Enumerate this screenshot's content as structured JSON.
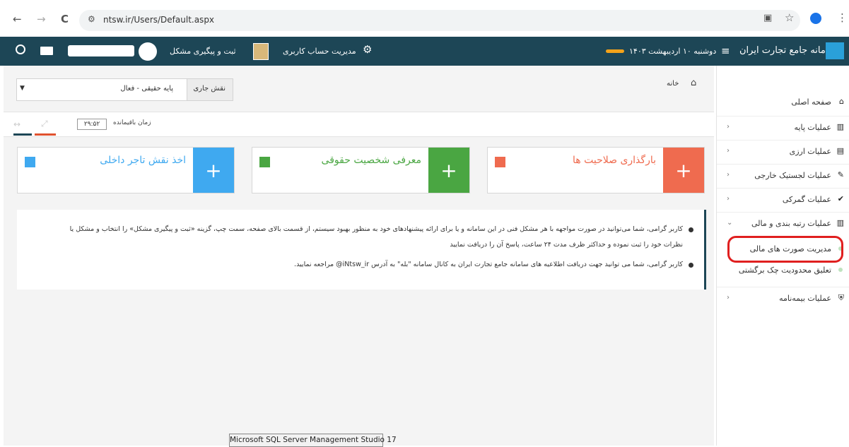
{
  "browser": {
    "back": "←",
    "forward": "→",
    "reload": "C",
    "url": "ntsw.ir/Users/Default.aspx"
  },
  "header": {
    "brand": "سامانه جامع تجارت ایران",
    "date": "دوشنبه ۱۰ اردیبهشت ۱۴۰۳",
    "account_mgmt": "مدیریت حساب کاربری",
    "register_issue": "ثبت و پیگیری مشکل"
  },
  "breadcrumb": {
    "home": "خانه"
  },
  "role": {
    "label": "نقش جاری",
    "value": "پایه حقیقی - فعال"
  },
  "timer": {
    "label": "زمان باقیمانده",
    "value": "۲۹:۵۲"
  },
  "cards": [
    {
      "title": "بارگذاری صلاحیت ها",
      "color": "#ef6b4f"
    },
    {
      "title": "معرفی شخصیت حقوقی",
      "color": "#4aa642"
    },
    {
      "title": "اخذ نقش تاجر داخلی",
      "color": "#3fa9f0"
    }
  ],
  "notice": {
    "line1": "کاربر گرامی، شما می‌توانید در صورت مواجهه با هر مشکل فنی در این سامانه و یا برای ارائه پیشنهادهای خود به منظور بهبود سیستم، از قسمت بالای صفحه، سمت چپ، گزینه «ثبت و پیگیری مشکل» را انتخاب و مشکل یا",
    "line2": "نظرات خود را ثبت نموده و حداکثر ظرف مدت ۲۴ ساعت، پاسخ آن را دریافت نمایید",
    "line3": "کاربر گرامی، شما می توانید جهت دریافت اطلاعیه های سامانه جامع تجارت ایران به کانال سامانه \"بله\" به آدرس iNtsw_ir@ مراجعه نمایید."
  },
  "sidebar": {
    "items": [
      {
        "label": "صفحه اصلی",
        "icon": "home-icon"
      },
      {
        "label": "عملیات پایه",
        "icon": "chart-icon"
      },
      {
        "label": "عملیات ارزی",
        "icon": "currency-icon"
      },
      {
        "label": "عملیات لجستیک خارجی",
        "icon": "edit-icon"
      },
      {
        "label": "عملیات گمرکی",
        "icon": "check-icon"
      },
      {
        "label": "عملیات رتبه بندی و مالی",
        "icon": "chart-icon"
      },
      {
        "label": "عملیات بیمه‌نامه",
        "icon": "shield-icon"
      }
    ],
    "subitems": [
      {
        "label": "مدیریت صورت های مالی"
      },
      {
        "label": "تعلیق محدودیت چک برگشتی"
      }
    ]
  },
  "tooltip": "Microsoft SQL Server Management Studio 17",
  "colors": {
    "header": "#1d4656",
    "highlight": "#e01f1f"
  }
}
